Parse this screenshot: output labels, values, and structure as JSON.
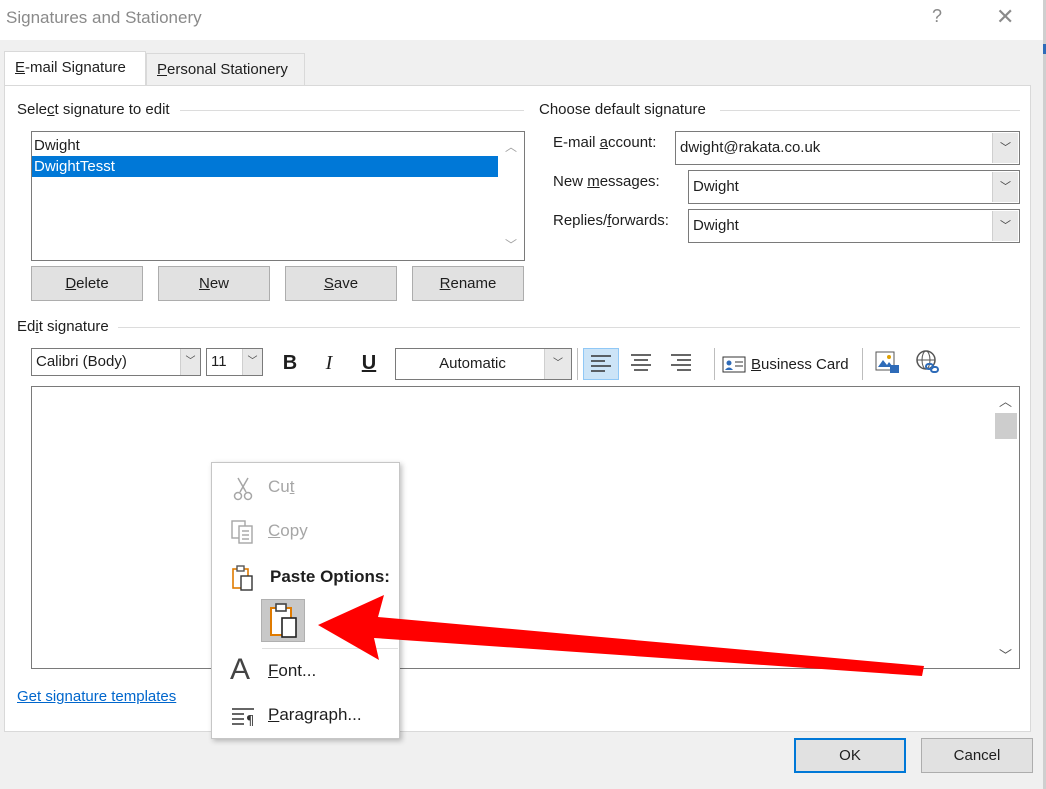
{
  "window": {
    "title": "Signatures and Stationery",
    "help_glyph": "?",
    "close_glyph": "✕"
  },
  "tabs": [
    {
      "label": "E-mail Signature",
      "accel": "E",
      "rest": "-mail Signature"
    },
    {
      "label": "Personal Stationery",
      "accel": "P",
      "rest": "ersonal Stationery"
    }
  ],
  "select_signature": {
    "heading_pre": "Sele",
    "heading_accel": "c",
    "heading_post": "t signature to edit",
    "items": [
      "Dwight",
      "DwightTesst"
    ],
    "selected_index": 1
  },
  "sig_buttons": {
    "delete": {
      "accel": "D",
      "rest": "elete"
    },
    "new": {
      "accel": "N",
      "rest": "ew"
    },
    "save": {
      "accel": "S",
      "rest": "ave"
    },
    "rename": {
      "accel": "R",
      "rest": "ename"
    }
  },
  "default_signature": {
    "heading": "Choose default signature",
    "email_label_pre": "E-mail ",
    "email_label_accel": "a",
    "email_label_post": "ccount:",
    "email_value": "dwight@rakata.co.uk",
    "new_label_pre": "New ",
    "new_label_accel": "m",
    "new_label_post": "essages:",
    "new_value": "Dwight",
    "replies_label_pre": "Replies/",
    "replies_label_accel": "f",
    "replies_label_post": "orwards:",
    "replies_value": "Dwight"
  },
  "edit_signature": {
    "heading_pre": "Ed",
    "heading_accel": "i",
    "heading_post": "t signature",
    "font": "Calibri (Body)",
    "size": "11",
    "color": "Automatic",
    "bold": "B",
    "italic": "I",
    "underline": "U",
    "business_card_accel": "B",
    "business_card_rest": "usiness Card",
    "alignment": "left"
  },
  "templates_link": "Get signature templates",
  "dialog_buttons": {
    "ok": "OK",
    "cancel": "Cancel"
  },
  "context_menu": {
    "cut": {
      "accel": "t",
      "pre": "Cu",
      "enabled": false
    },
    "copy": {
      "accel": "C",
      "rest": "opy",
      "enabled": false
    },
    "paste_options": "Paste Options:",
    "font": {
      "accel": "F",
      "rest": "ont..."
    },
    "paragraph": {
      "accel": "P",
      "rest": "aragraph..."
    }
  },
  "colors": {
    "accent": "#0078d7",
    "arrow": "#ff0000",
    "paste_icon": "#e07b00"
  },
  "icons": [
    "scissors-icon",
    "copy-icon",
    "paste-options-icon",
    "paste-keep-formatting-icon",
    "font-icon",
    "paragraph-icon",
    "business-card-icon",
    "insert-picture-icon",
    "hyperlink-icon"
  ]
}
